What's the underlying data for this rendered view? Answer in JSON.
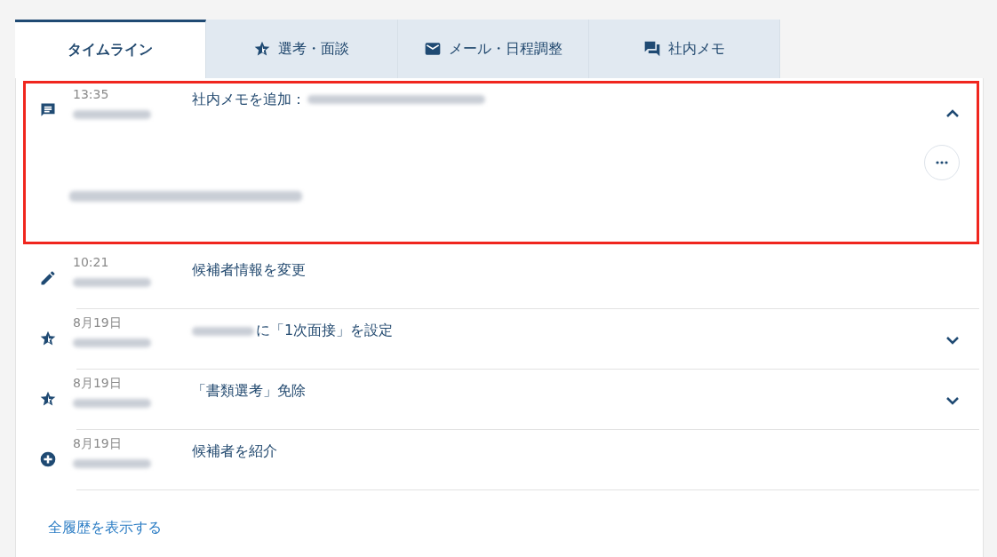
{
  "tabs": [
    {
      "label": "タイムライン",
      "selected": true
    },
    {
      "label": "選考・面談",
      "selected": false
    },
    {
      "label": "メール・日程調整",
      "selected": false
    },
    {
      "label": "社内メモ",
      "selected": false
    }
  ],
  "timeline": [
    {
      "kind": "memo",
      "time": "13:35",
      "action": "社内メモを追加：",
      "redacted_before": false,
      "redacted_after": true,
      "expandable": true,
      "highlighted": true,
      "expanded": true
    },
    {
      "kind": "edit",
      "time": "10:21",
      "action": "候補者情報を変更",
      "redacted_before": false,
      "redacted_after": false,
      "expandable": false,
      "highlighted": false,
      "expanded": false
    },
    {
      "kind": "star",
      "time": "8月19日",
      "action": "に「1次面接」を設定",
      "redacted_before": true,
      "redacted_after": false,
      "expandable": true,
      "highlighted": false,
      "expanded": false
    },
    {
      "kind": "star",
      "time": "8月19日",
      "action": "「書類選考」免除",
      "redacted_before": false,
      "redacted_after": false,
      "expandable": true,
      "highlighted": false,
      "expanded": false
    },
    {
      "kind": "add",
      "time": "8月19日",
      "action": "候補者を紹介",
      "redacted_before": false,
      "redacted_after": false,
      "expandable": false,
      "highlighted": false,
      "expanded": false
    }
  ],
  "show_all_link": "全履歴を表示する"
}
